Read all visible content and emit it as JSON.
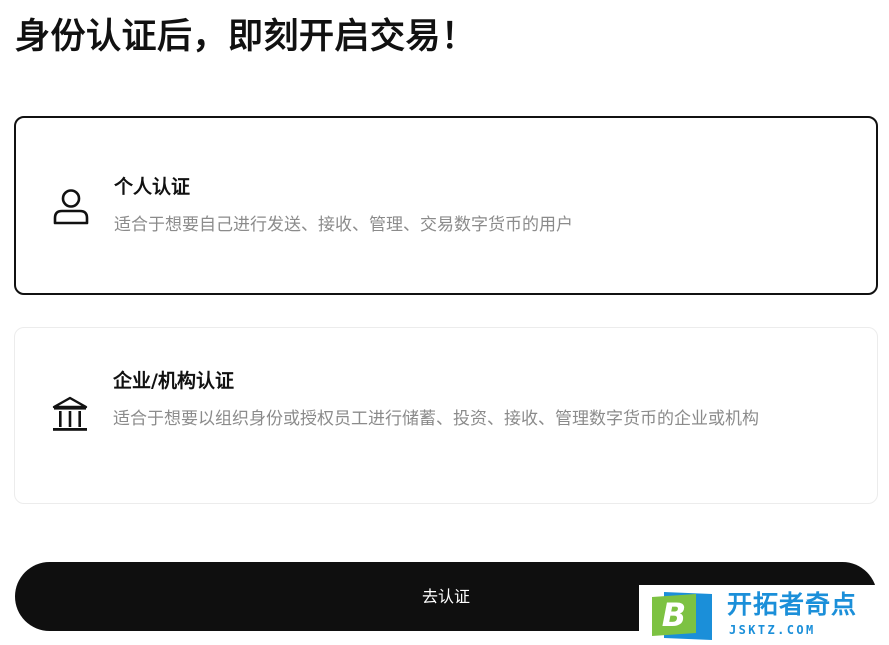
{
  "header": {
    "title": "身份认证后，即刻开启交易！"
  },
  "options": [
    {
      "title": "个人认证",
      "description": "适合于想要自己进行发送、接收、管理、交易数字货币的用户",
      "icon": "user-icon",
      "selected": true
    },
    {
      "title": "企业/机构认证",
      "description": "适合于想要以组织身份或授权员工进行储蓄、投资、接收、管理数字货币的企业或机构",
      "icon": "bank-icon",
      "selected": false
    }
  ],
  "action": {
    "submit_label": "去认证"
  },
  "watermark": {
    "logo_letter": "B",
    "name": "开拓者奇点",
    "domain": "JSKTZ.COM"
  },
  "colors": {
    "text_primary": "#111111",
    "text_secondary": "#8b8b8b",
    "selected_border": "#111111",
    "unselected_border": "#ececec",
    "button_background": "#0f0f0f",
    "button_text": "#ffffff",
    "watermark_blue": "#1b8fd9",
    "watermark_green": "#7dc242"
  }
}
